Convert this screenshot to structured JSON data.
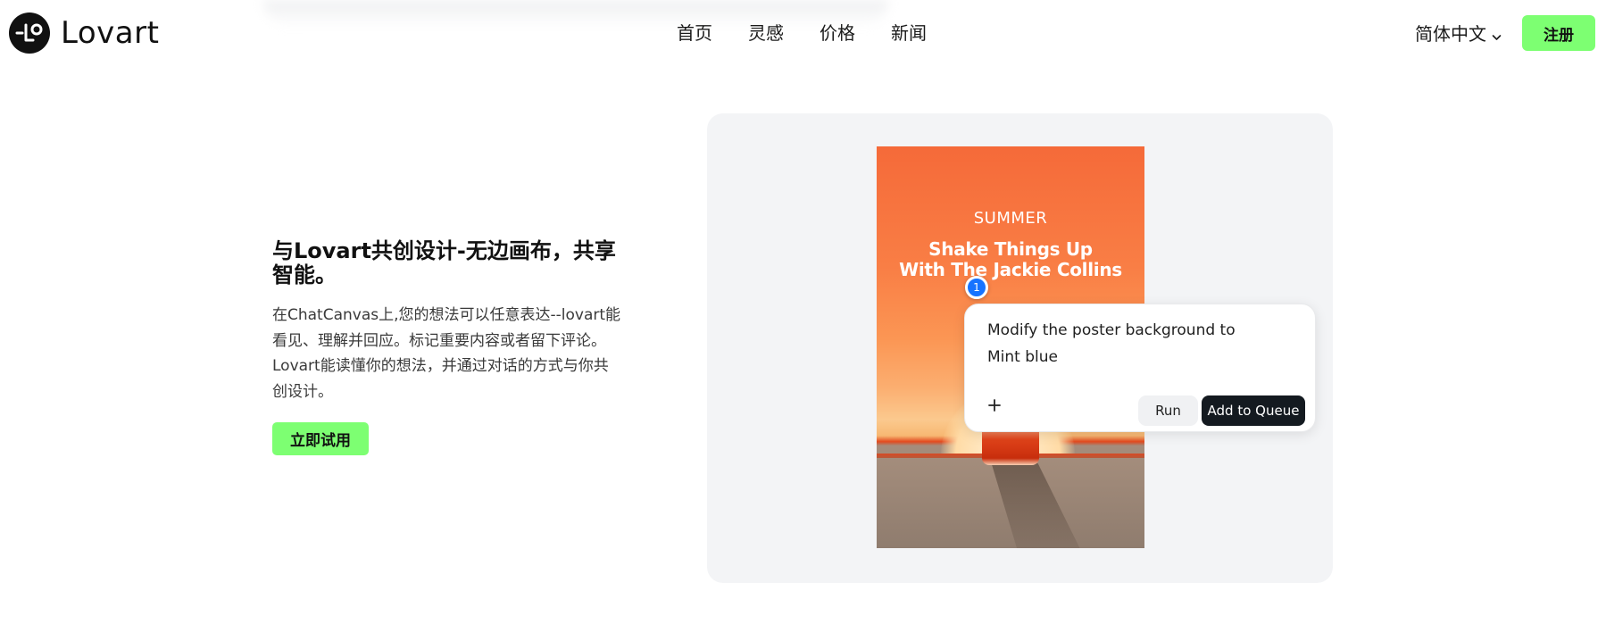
{
  "header": {
    "logo_text": "Lovart",
    "nav": [
      {
        "label": "首页"
      },
      {
        "label": "灵感"
      },
      {
        "label": "价格"
      },
      {
        "label": "新闻"
      }
    ],
    "language": "简体中文",
    "signup_label": "注册"
  },
  "hero": {
    "title": "与Lovart共创设计-无边画布，共享智能。",
    "description": "在ChatCanvas上,您的想法可以任意表达--lovart能看见、理解并回应。标记重要内容或者留下评论。Lovart能读懂你的想法，并通过对话的方式与你共创设计。",
    "cta_label": "立即试用"
  },
  "showcase": {
    "poster": {
      "kicker": "SUMMER",
      "headline_line1": "Shake Things Up",
      "headline_line2": "With The Jackie Collins"
    },
    "marker_number": "1",
    "prompt": {
      "text_line1": "Modify the poster background to",
      "text_line2": "Mint blue",
      "run_label": "Run",
      "queue_label": "Add to Queue"
    }
  },
  "colors": {
    "accent_green": "#7dff72",
    "marker_blue": "#1673ff",
    "dark_button": "#141a20",
    "panel_bg": "#f3f4f6"
  },
  "icons": {
    "logo": "lovart-logo-icon",
    "language_chevron": "chevron-down-icon",
    "add": "plus-icon"
  }
}
